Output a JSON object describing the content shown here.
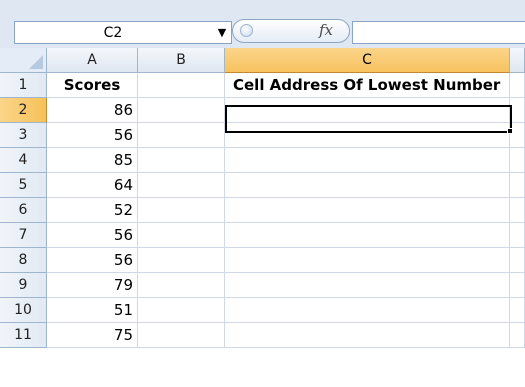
{
  "formula_bar": {
    "name_box": "C2",
    "name_box_dropdown_icon": "triangle-down",
    "fx_label": "fx",
    "formula_value": ""
  },
  "sheet": {
    "columns": [
      "A",
      "B",
      "C"
    ],
    "selected_column": "C",
    "rows": [
      "1",
      "2",
      "3",
      "4",
      "5",
      "6",
      "7",
      "8",
      "9",
      "10",
      "11"
    ],
    "selected_row": "2",
    "cells": {
      "A1": "Scores",
      "C1": "Cell Address Of Lowest Number",
      "A": [
        "86",
        "56",
        "85",
        "64",
        "52",
        "56",
        "56",
        "79",
        "51",
        "75"
      ]
    },
    "active_cell": "C2",
    "active_cell_value": ""
  },
  "colors": {
    "selected_header": "#f7c25f",
    "gridline": "#d0d7e5",
    "header_border": "#9eb6ce"
  }
}
